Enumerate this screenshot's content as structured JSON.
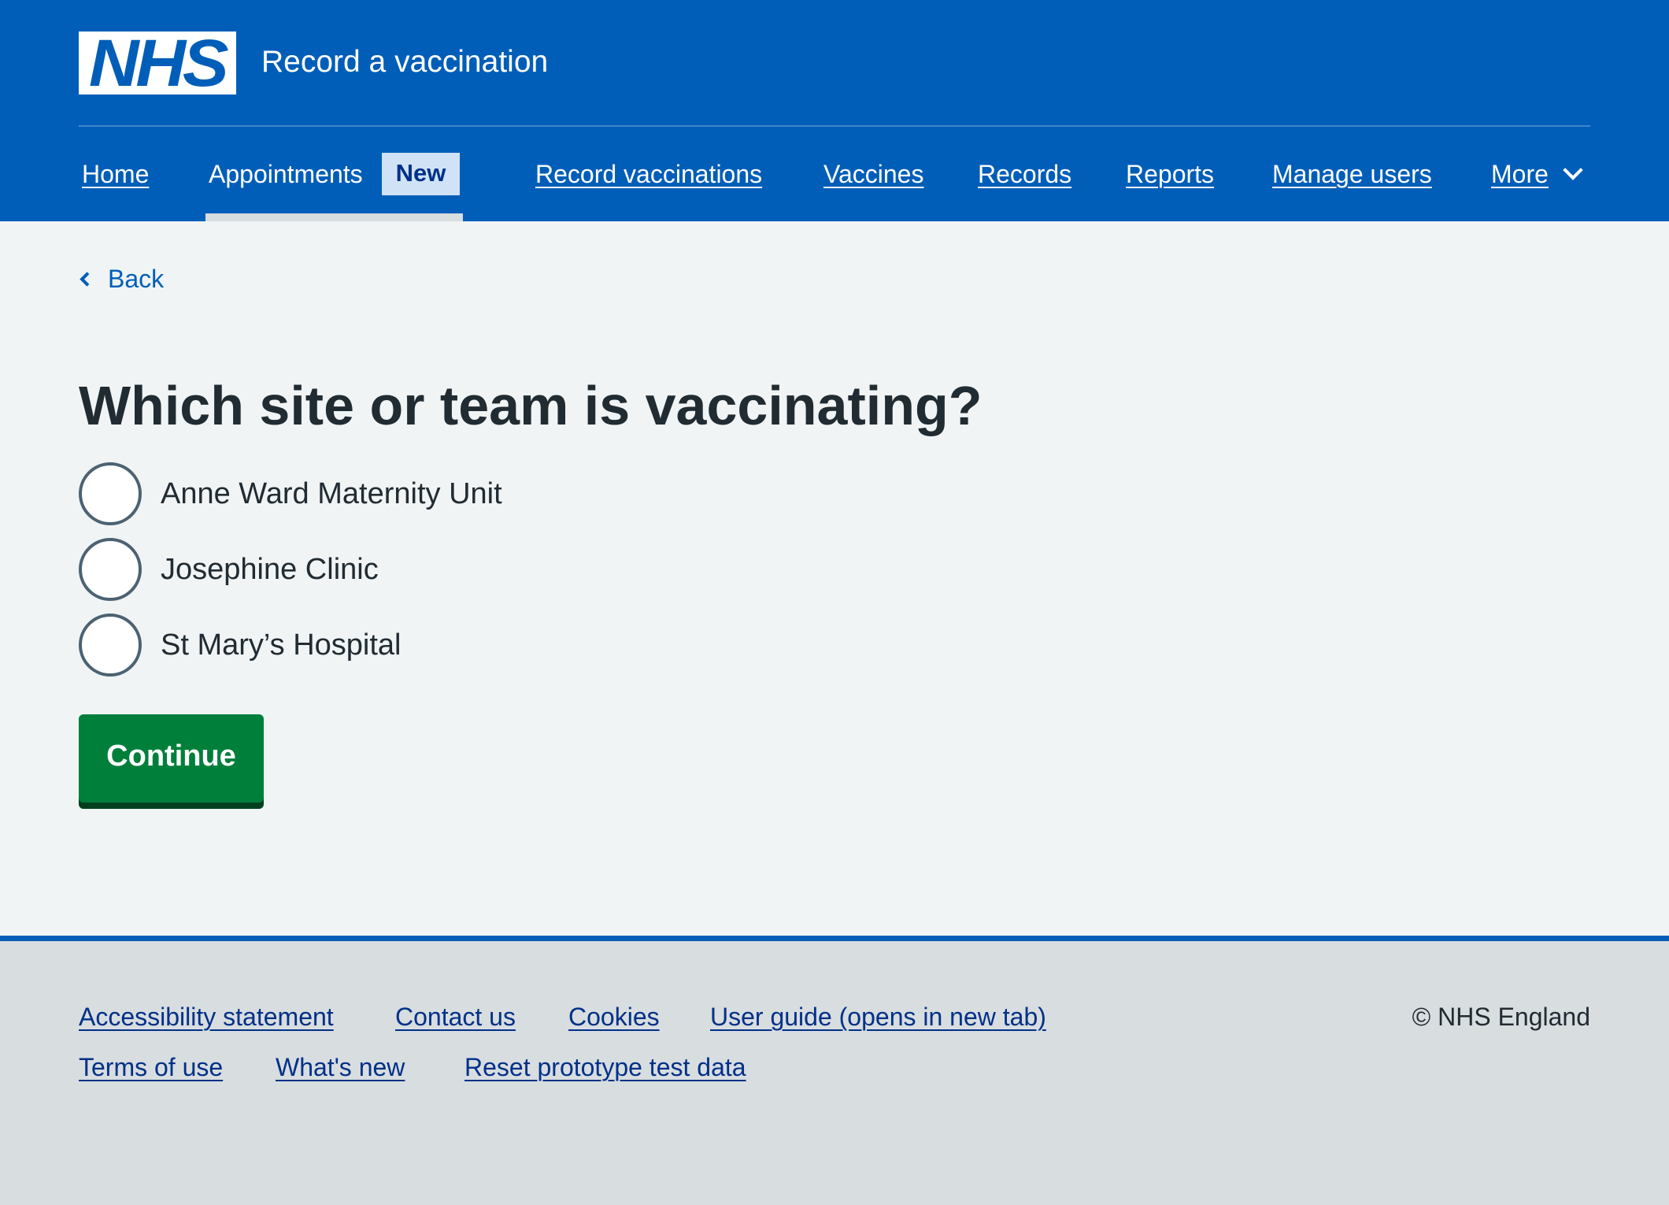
{
  "header": {
    "logo_text": "NHS",
    "service_name": "Record a vaccination",
    "nav": [
      {
        "label": "Home"
      },
      {
        "label": "Appointments",
        "tag": "New",
        "active": true
      },
      {
        "label": "Record vaccinations"
      },
      {
        "label": "Vaccines"
      },
      {
        "label": "Records"
      },
      {
        "label": "Reports"
      },
      {
        "label": "Manage users"
      },
      {
        "label": "More",
        "icon": "chevron-down-icon"
      }
    ]
  },
  "main": {
    "back_label": "Back",
    "title": "Which site or team is vaccinating?",
    "options": [
      {
        "label": "Anne Ward Maternity Unit",
        "selected": false
      },
      {
        "label": "Josephine Clinic",
        "selected": false
      },
      {
        "label": "St Mary’s Hospital",
        "selected": false
      }
    ],
    "continue_label": "Continue"
  },
  "footer": {
    "links_row1": [
      "Accessibility statement",
      "Contact us",
      "Cookies",
      "User guide (opens in new tab)"
    ],
    "links_row2": [
      "Terms of use",
      "What's new",
      "Reset prototype test data"
    ],
    "copyright": "© NHS England"
  },
  "colors": {
    "brand_blue": "#005eb8",
    "page_background": "#f0f4f5",
    "footer_background": "#d8dde0",
    "button_green": "#007f3b",
    "link_dark_blue": "#003087",
    "text": "#212b32"
  }
}
